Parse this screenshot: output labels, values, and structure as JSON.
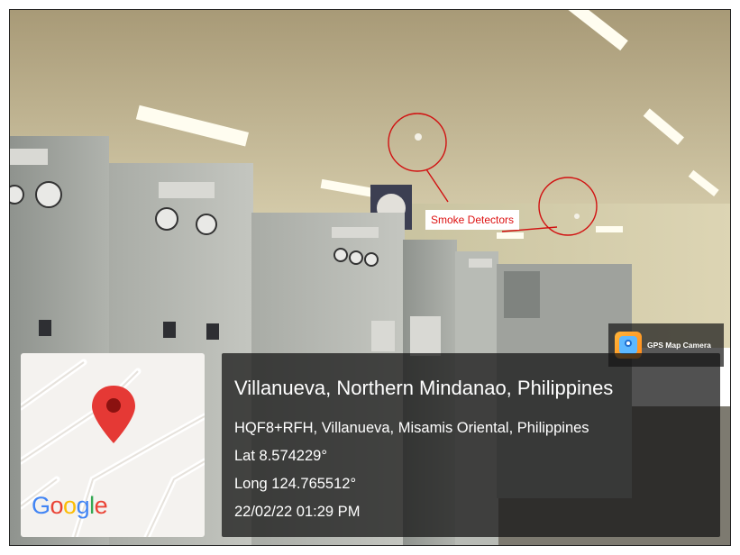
{
  "annotation": {
    "label": "Smoke Detectors",
    "color": "#d11111"
  },
  "gps_badge": {
    "label": "GPS Map Camera",
    "icon": "gps-map-camera-app-icon"
  },
  "map": {
    "logo_letters": [
      {
        "char": "G",
        "color": "#4285f4"
      },
      {
        "char": "o",
        "color": "#ea4335"
      },
      {
        "char": "o",
        "color": "#fbbc05"
      },
      {
        "char": "g",
        "color": "#4285f4"
      },
      {
        "char": "l",
        "color": "#34a853"
      },
      {
        "char": "e",
        "color": "#ea4335"
      }
    ],
    "pin_icon": "map-pin-icon",
    "pin_color": "#e53935"
  },
  "location": {
    "title": "Villanueva, Northern Mindanao, Philippines",
    "address": "HQF8+RFH, Villanueva, Misamis Oriental, Philippines",
    "latitude": "Lat 8.574229°",
    "longitude": "Long 124.765512°",
    "datetime": "22/02/22 01:29 PM"
  }
}
